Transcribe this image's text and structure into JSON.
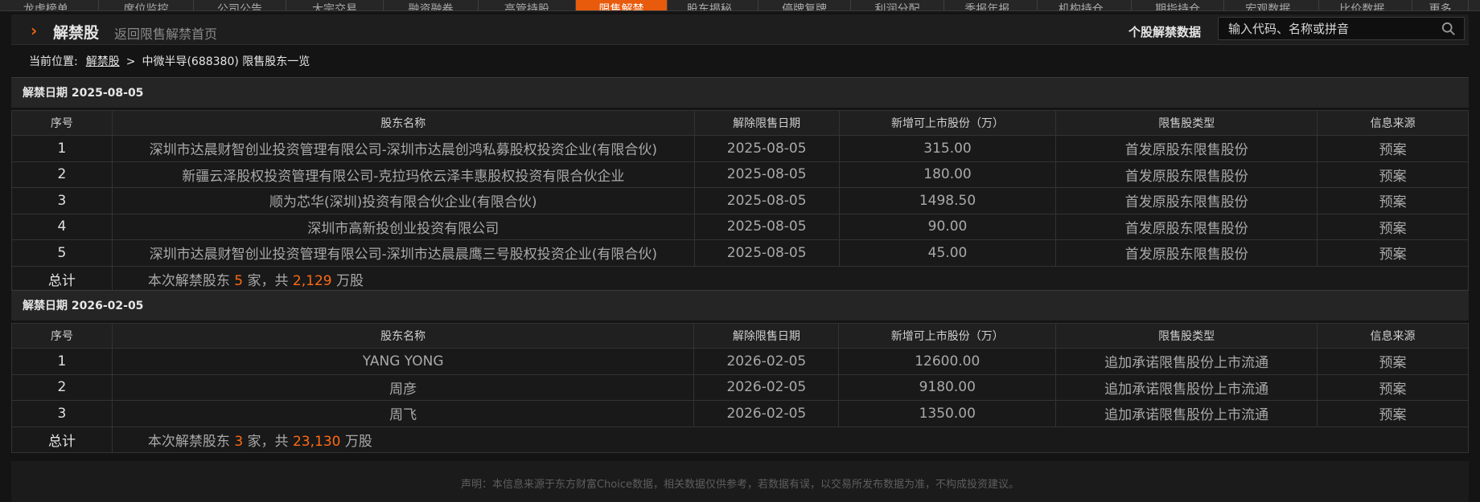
{
  "nav": {
    "items": [
      {
        "label": "龙虎榜单",
        "caret": true,
        "w": 123
      },
      {
        "label": "席位监控",
        "caret": false,
        "w": 118
      },
      {
        "label": "公司公告",
        "caret": false,
        "w": 115
      },
      {
        "label": "大宗交易",
        "caret": false,
        "w": 121
      },
      {
        "label": "融资融券",
        "caret": false,
        "w": 118
      },
      {
        "label": "高管持股",
        "caret": false,
        "w": 121
      },
      {
        "label": "限售解禁",
        "caret": false,
        "w": 114
      },
      {
        "label": "股东揭秘",
        "caret": true,
        "w": 113
      },
      {
        "label": "停牌复牌",
        "caret": false,
        "w": 115
      },
      {
        "label": "利润分配",
        "caret": false,
        "w": 116
      },
      {
        "label": "季报年报",
        "caret": true,
        "w": 116
      },
      {
        "label": "机构持仓",
        "caret": true,
        "w": 117
      },
      {
        "label": "期指持仓",
        "caret": false,
        "w": 115
      },
      {
        "label": "宏观数据",
        "caret": true,
        "w": 118
      },
      {
        "label": "比价数据",
        "caret": true,
        "w": 116
      },
      {
        "label": "更多",
        "caret": false,
        "w": 70
      }
    ],
    "active_index": 6
  },
  "header": {
    "title": "解禁股",
    "back_link": "返回限售解禁首页",
    "search_label": "个股解禁数据",
    "search_placeholder": "输入代码、名称或拼音"
  },
  "breadcrumb": {
    "prefix": "当前位置:",
    "link": "解禁股",
    "sep": ">",
    "current": "中微半导(688380) 限售股东一览"
  },
  "columns": [
    "序号",
    "股东名称",
    "解除限售日期",
    "新增可上市股份（万）",
    "限售股类型",
    "信息来源"
  ],
  "sections": [
    {
      "heading": "解禁日期 2025-08-05",
      "rows": [
        {
          "seq": "1",
          "holder": "深圳市达晨财智创业投资管理有限公司-深圳市达晨创鸿私募股权投资企业(有限合伙)",
          "date": "2025-08-05",
          "shares": "315.00",
          "type": "首发原股东限售股份",
          "source": "预案"
        },
        {
          "seq": "2",
          "holder": "新疆云泽股权投资管理有限公司-克拉玛依云泽丰惠股权投资有限合伙企业",
          "date": "2025-08-05",
          "shares": "180.00",
          "type": "首发原股东限售股份",
          "source": "预案"
        },
        {
          "seq": "3",
          "holder": "顺为芯华(深圳)投资有限合伙企业(有限合伙)",
          "date": "2025-08-05",
          "shares": "1498.50",
          "type": "首发原股东限售股份",
          "source": "预案"
        },
        {
          "seq": "4",
          "holder": "深圳市高新投创业投资有限公司",
          "date": "2025-08-05",
          "shares": "90.00",
          "type": "首发原股东限售股份",
          "source": "预案"
        },
        {
          "seq": "5",
          "holder": "深圳市达晨财智创业投资管理有限公司-深圳市达晨晨鹰三号股权投资企业(有限合伙)",
          "date": "2025-08-05",
          "shares": "45.00",
          "type": "首发原股东限售股份",
          "source": "预案"
        }
      ],
      "total": {
        "label": "总计",
        "pre": "本次解禁股东 ",
        "count": "5",
        "mid": " 家，共 ",
        "amount": "2,129",
        "post": " 万股"
      }
    },
    {
      "heading": "解禁日期 2026-02-05",
      "rows": [
        {
          "seq": "1",
          "holder": "YANG YONG",
          "date": "2026-02-05",
          "shares": "12600.00",
          "type": "追加承诺限售股份上市流通",
          "source": "预案"
        },
        {
          "seq": "2",
          "holder": "周彦",
          "date": "2026-02-05",
          "shares": "9180.00",
          "type": "追加承诺限售股份上市流通",
          "source": "预案"
        },
        {
          "seq": "3",
          "holder": "周飞",
          "date": "2026-02-05",
          "shares": "1350.00",
          "type": "追加承诺限售股份上市流通",
          "source": "预案"
        }
      ],
      "total": {
        "label": "总计",
        "pre": "本次解禁股东 ",
        "count": "3",
        "mid": " 家，共 ",
        "amount": "23,130",
        "post": " 万股"
      }
    }
  ],
  "disclaimer": "声明：本信息来源于东方财富Choice数据，相关数据仅供参考，若数据有误，以交易所发布数据为准，不构成投资建议。",
  "colors": {
    "accent": "#e85a0c",
    "highlight": "#ff6a14",
    "background": "#141414"
  }
}
